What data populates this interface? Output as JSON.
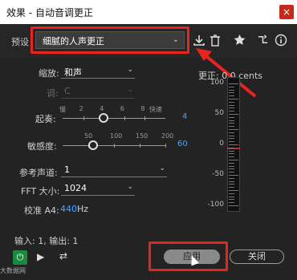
{
  "window": {
    "title": "效果 - 自动音调更正",
    "close_glyph": "×"
  },
  "preset": {
    "label": "预设",
    "value": "细腻的人声更正"
  },
  "toolbar_icons": [
    "download-icon",
    "trash-icon",
    "star-icon",
    "routing-icon",
    "info-icon"
  ],
  "scale": {
    "label": "缩放:",
    "value": "和声"
  },
  "key": {
    "label": "调:",
    "value": "C"
  },
  "attack": {
    "label": "起奏:",
    "left_label": "慢",
    "right_label": "快速",
    "ticks": [
      "2",
      "4",
      "6",
      "8"
    ],
    "value_text": "4",
    "value": 4
  },
  "sensitivity": {
    "label": "敏感度:",
    "ticks": [
      "50",
      "100",
      "150",
      "200"
    ],
    "value_text": "60",
    "value": 60
  },
  "ref_channel": {
    "label": "参考声道:",
    "value": "1"
  },
  "fft": {
    "label": "FFT 大小:",
    "value": "1024"
  },
  "tuning": {
    "label": "校准 A4:",
    "value": "440",
    "unit": "Hz"
  },
  "correction": {
    "label": "更正: 0.0 cents",
    "scale": [
      "100",
      "50",
      "0",
      "-50",
      "-100"
    ]
  },
  "io": {
    "text": "输入: 1, 输出: 1"
  },
  "buttons": {
    "apply": "应用",
    "close": "关闭"
  },
  "watermark": "大数据网",
  "colors": {
    "accent_blue": "#4aa3ff",
    "highlight_red": "#e8241f",
    "power_green": "#1b8a3e"
  }
}
